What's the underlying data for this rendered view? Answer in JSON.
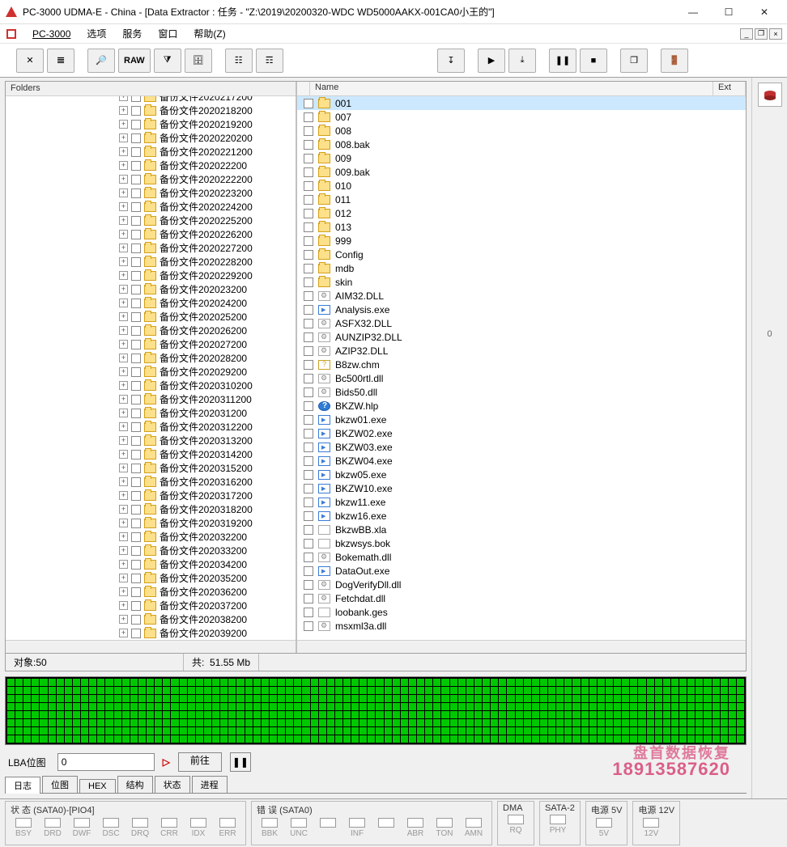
{
  "window": {
    "title": "PC-3000 UDMA-E - China - [Data Extractor : 任务 - \"Z:\\2019\\20200320-WDC WD5000AAKX-001CA0小王的\"]"
  },
  "menu": {
    "pc3000": "PC-3000",
    "options": "选项",
    "service": "服务",
    "window": "窗口",
    "help": "帮助(Z)"
  },
  "toolbar": {
    "raw": "RAW"
  },
  "rightstrip": {
    "zero": "0"
  },
  "leftpane": {
    "header": "Folders"
  },
  "tree": [
    "备份文件2020218200",
    "备份文件2020219200",
    "备份文件2020220200",
    "备份文件2020221200",
    "备份文件202022200",
    "备份文件2020222200",
    "备份文件2020223200",
    "备份文件2020224200",
    "备份文件2020225200",
    "备份文件2020226200",
    "备份文件2020227200",
    "备份文件2020228200",
    "备份文件2020229200",
    "备份文件202023200",
    "备份文件202024200",
    "备份文件202025200",
    "备份文件202026200",
    "备份文件202027200",
    "备份文件202028200",
    "备份文件202029200",
    "备份文件2020310200",
    "备份文件2020311200",
    "备份文件202031200",
    "备份文件2020312200",
    "备份文件2020313200",
    "备份文件2020314200",
    "备份文件2020315200",
    "备份文件2020316200",
    "备份文件2020317200",
    "备份文件2020318200",
    "备份文件2020319200",
    "备份文件202032200",
    "备份文件202033200",
    "备份文件202034200",
    "备份文件202035200",
    "备份文件202036200",
    "备份文件202037200",
    "备份文件202038200",
    "备份文件202039200"
  ],
  "listcols": {
    "name": "Name",
    "ext": "Ext"
  },
  "files": [
    {
      "n": "001",
      "t": "folder",
      "sel": true
    },
    {
      "n": "007",
      "t": "folder"
    },
    {
      "n": "008",
      "t": "folder"
    },
    {
      "n": "008.bak",
      "t": "folder"
    },
    {
      "n": "009",
      "t": "folder"
    },
    {
      "n": "009.bak",
      "t": "folder"
    },
    {
      "n": "010",
      "t": "folder"
    },
    {
      "n": "011",
      "t": "folder"
    },
    {
      "n": "012",
      "t": "folder"
    },
    {
      "n": "013",
      "t": "folder"
    },
    {
      "n": "999",
      "t": "folder"
    },
    {
      "n": "Config",
      "t": "folder"
    },
    {
      "n": "mdb",
      "t": "folder"
    },
    {
      "n": "skin",
      "t": "folder"
    },
    {
      "n": "AIM32.DLL",
      "t": "dll"
    },
    {
      "n": "Analysis.exe",
      "t": "exe"
    },
    {
      "n": "ASFX32.DLL",
      "t": "dll"
    },
    {
      "n": "AUNZIP32.DLL",
      "t": "dll"
    },
    {
      "n": "AZIP32.DLL",
      "t": "dll"
    },
    {
      "n": "B8zw.chm",
      "t": "chm"
    },
    {
      "n": "Bc500rtl.dll",
      "t": "dll"
    },
    {
      "n": "Bids50.dll",
      "t": "dll"
    },
    {
      "n": "BKZW.hlp",
      "t": "hlp"
    },
    {
      "n": "bkzw01.exe",
      "t": "exe"
    },
    {
      "n": "BKZW02.exe",
      "t": "exe"
    },
    {
      "n": "BKZW03.exe",
      "t": "exe"
    },
    {
      "n": "BKZW04.exe",
      "t": "exe"
    },
    {
      "n": "bkzw05.exe",
      "t": "exe"
    },
    {
      "n": "BKZW10.exe",
      "t": "exe"
    },
    {
      "n": "bkzw11.exe",
      "t": "exe"
    },
    {
      "n": "bkzw16.exe",
      "t": "exe"
    },
    {
      "n": "BkzwBB.xla",
      "t": "file"
    },
    {
      "n": "bkzwsys.bok",
      "t": "file"
    },
    {
      "n": "Bokemath.dll",
      "t": "dll"
    },
    {
      "n": "DataOut.exe",
      "t": "exe"
    },
    {
      "n": "DogVerifyDll.dll",
      "t": "dll"
    },
    {
      "n": "Fetchdat.dll",
      "t": "dll"
    },
    {
      "n": "loobank.ges",
      "t": "file"
    },
    {
      "n": "msxml3a.dll",
      "t": "dll"
    }
  ],
  "status": {
    "objects_label": "对象:",
    "objects_value": "50",
    "total_label": "共:",
    "total_value": "51.55 Mb"
  },
  "lba": {
    "label": "LBA位图",
    "value": "0",
    "goto": "前往"
  },
  "watermark": {
    "line1": "盘首数据恢复",
    "line2": "18913587620"
  },
  "tabs": [
    "日志",
    "位图",
    "HEX",
    "结构",
    "状态",
    "进程"
  ],
  "bottom": {
    "status_label": "状 态 (SATA0)-[PIO4]",
    "status_leds": [
      "BSY",
      "DRD",
      "DWF",
      "DSC",
      "DRQ",
      "CRR",
      "IDX",
      "ERR"
    ],
    "error_label": "错 误 (SATA0)",
    "error_leds": [
      "BBK",
      "UNC",
      "",
      "INF",
      "",
      "ABR",
      "TON",
      "AMN"
    ],
    "dma_label": "DMA",
    "dma_leds": [
      "RQ"
    ],
    "sata2_label": "SATA-2",
    "sata2_leds": [
      "PHY"
    ],
    "p5_label": "电源 5V",
    "p5_leds": [
      "5V"
    ],
    "p12_label": "电源 12V",
    "p12_leds": [
      "12V"
    ]
  }
}
